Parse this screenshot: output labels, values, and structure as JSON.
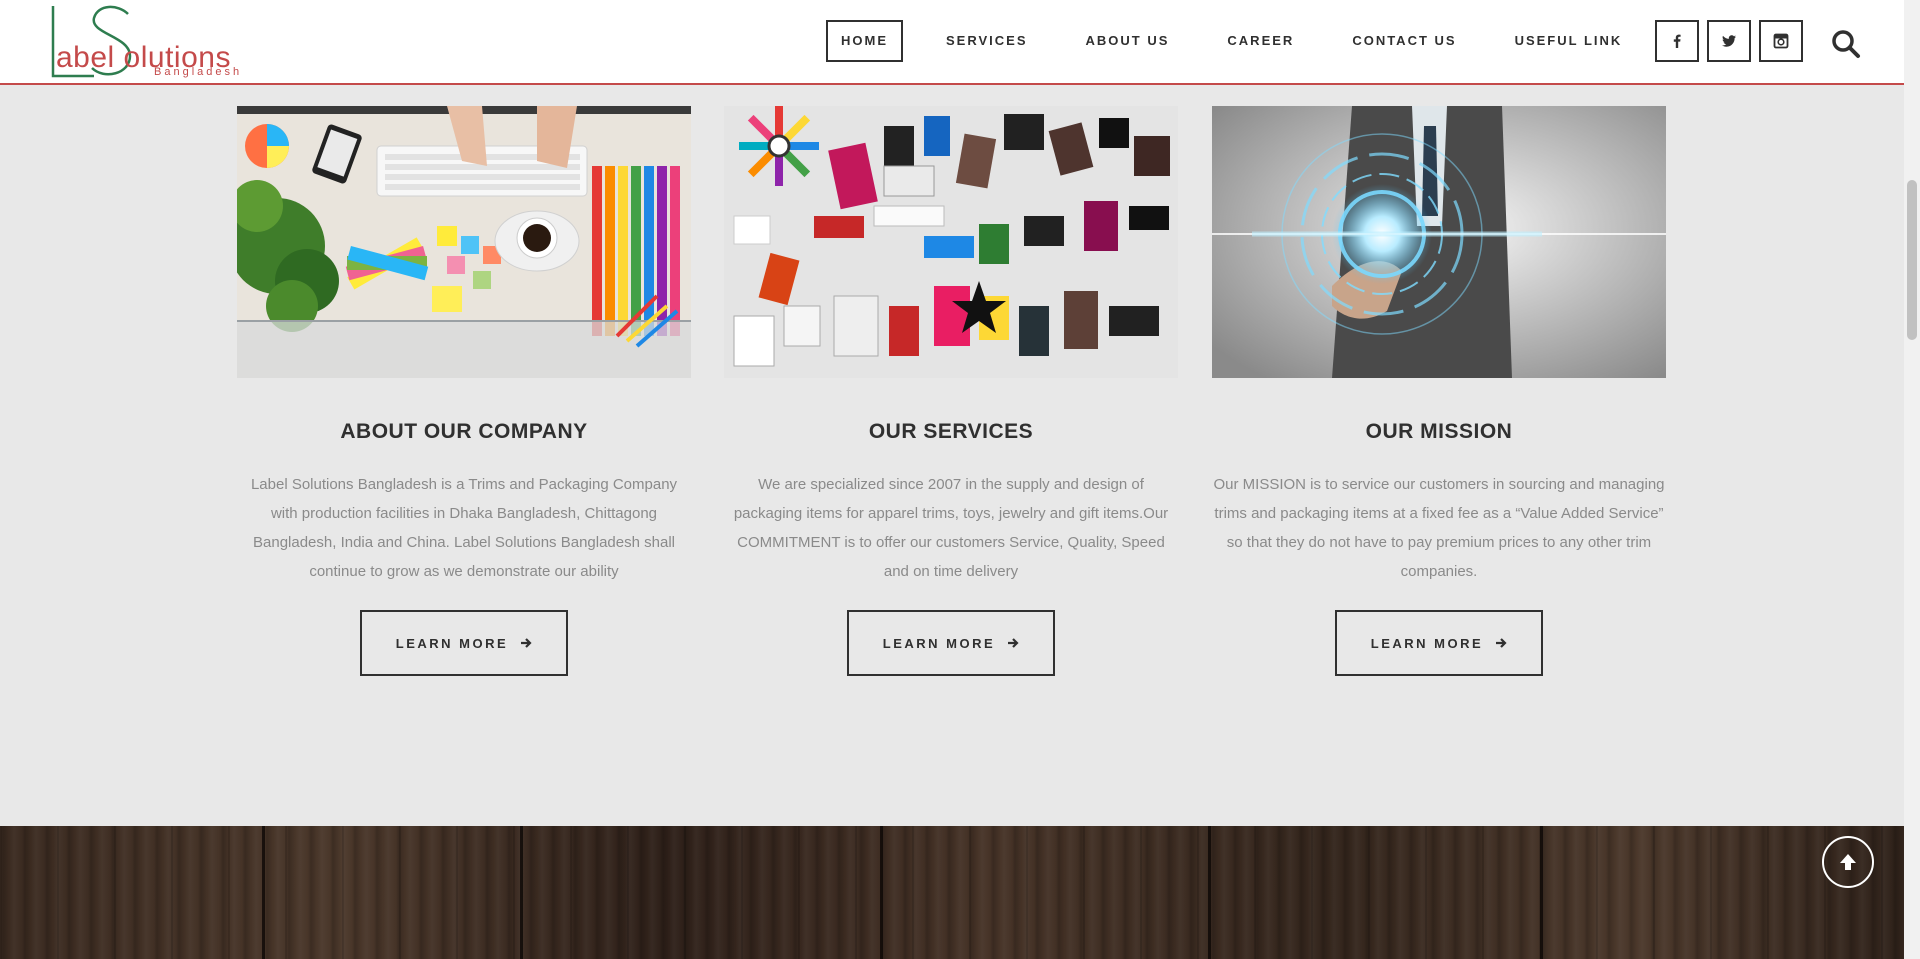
{
  "brand": {
    "logo_text": "abel olutions",
    "logo_sub": "Bangladesh",
    "primary_color": "#2e7d4f",
    "accent_color": "#c44a4a"
  },
  "nav": {
    "items": [
      {
        "label": "HOME",
        "active": true
      },
      {
        "label": "SERVICES",
        "active": false
      },
      {
        "label": "ABOUT US",
        "active": false
      },
      {
        "label": "CAREER",
        "active": false
      },
      {
        "label": "CONTACT US",
        "active": false
      },
      {
        "label": "USEFUL LINK",
        "active": false
      }
    ]
  },
  "social": {
    "icons": [
      "facebook-icon",
      "twitter-icon",
      "instagram-icon"
    ]
  },
  "search": {
    "icon": "search-icon"
  },
  "columns": [
    {
      "image": "designer-desk-color-swatches",
      "title": "ABOUT OUR COMPANY",
      "text": "Label Solutions Bangladesh is a Trims and Packaging Company with production facilities in Dhaka Bangladesh, Chittagong Bangladesh, India and China. Label Solutions Bangladesh shall continue to grow as we demonstrate our ability",
      "button": "LEARN MORE"
    },
    {
      "image": "assorted-labels-and-tags",
      "title": "OUR SERVICES",
      "text": "We are specialized since 2007 in the supply and design of packaging items for apparel trims, toys, jewelry and gift items.Our COMMITMENT is to offer our customers Service, Quality, Speed and on time delivery",
      "button": "LEARN MORE"
    },
    {
      "image": "businessman-touching-digital-interface",
      "title": "OUR MISSION",
      "text": "Our MISSION is to service our customers in sourcing and managing trims and packaging items at a fixed fee as a “Value Added Service” so that they do not have to pay premium prices to any other trim companies.",
      "button": "LEARN MORE"
    }
  ],
  "footer": {
    "scroll_top_icon": "arrow-up-icon"
  }
}
